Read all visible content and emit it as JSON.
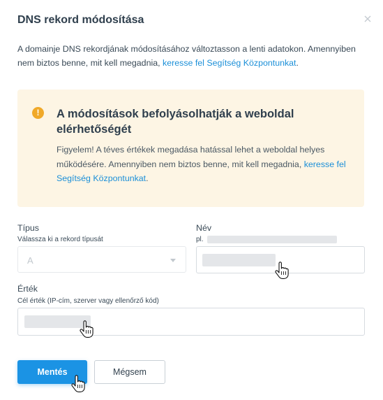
{
  "dialog": {
    "title": "DNS rekord módosítása",
    "close_icon": "close-icon",
    "intro_text": "A domainje DNS rekordjának módosításához változtasson a lenti adatokon. Amennyiben nem biztos benne, mit kell megadnia,",
    "intro_link": "keresse fel Segítség Központunkat",
    "intro_end": "."
  },
  "warning": {
    "icon": "exclamation-icon",
    "icon_glyph": "!",
    "title": "A módosítások befolyásolhatják a weboldal elérhetőségét",
    "text": "Figyelem! A téves értékek megadása hatással lehet a weboldal helyes működésére. Amennyiben nem biztos benne, mit kell megadnia,",
    "link": "keresse fel Segítség Központunkat",
    "end": "."
  },
  "form": {
    "type": {
      "label": "Típus",
      "hint": "Válassza ki a rekord típusát",
      "value": "A"
    },
    "name": {
      "label": "Név",
      "hint_prefix": "pl."
    },
    "value": {
      "label": "Érték",
      "hint": "Cél érték (IP-cím, szerver vagy ellenőrző kód)"
    }
  },
  "actions": {
    "save": "Mentés",
    "cancel": "Mégsem"
  },
  "colors": {
    "primary": "#1b93e4",
    "link": "#1b8fd8",
    "warning_bg": "#fdf5e4",
    "warning_icon": "#f0a929"
  }
}
